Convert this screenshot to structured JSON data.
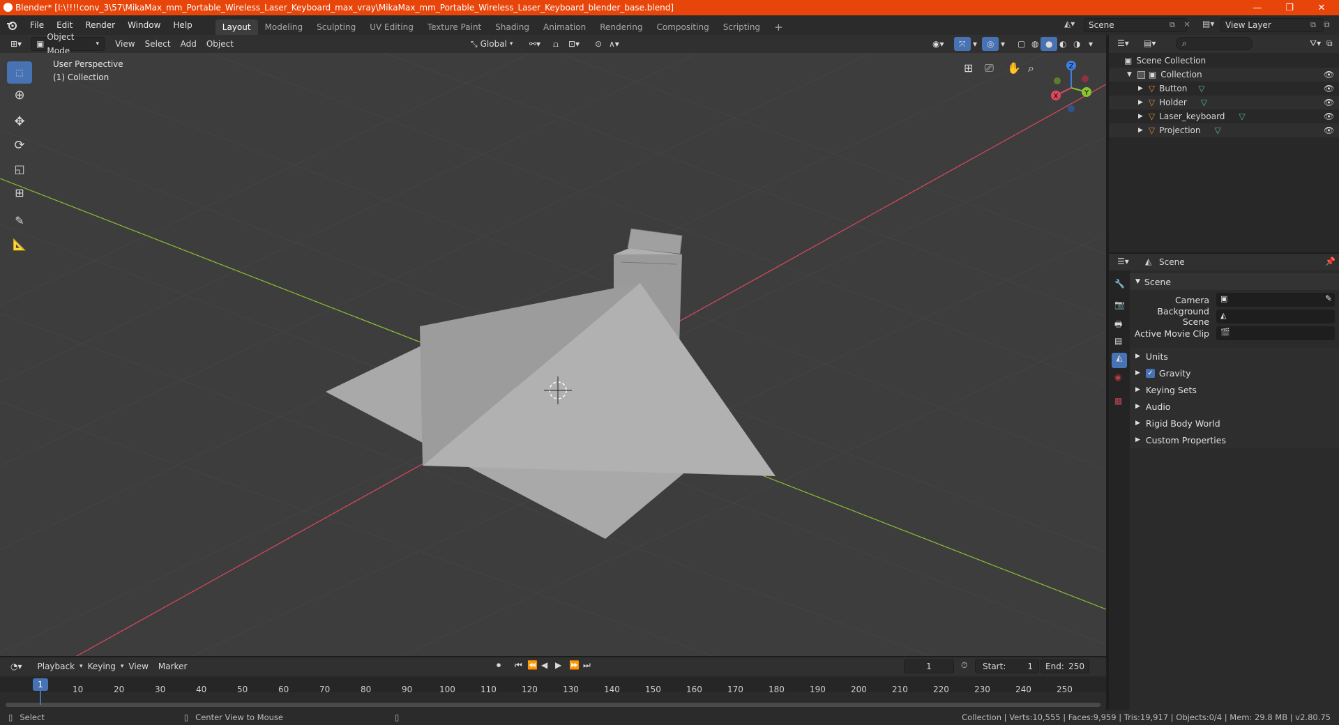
{
  "window": {
    "title": "Blender* [I:\\!!!!conv_3\\57\\MikaMax_mm_Portable_Wireless_Laser_Keyboard_max_vray\\MikaMax_mm_Portable_Wireless_Laser_Keyboard_blender_base.blend]",
    "minimize": "—",
    "maximize": "❐",
    "close": "✕"
  },
  "menu": [
    "File",
    "Edit",
    "Render",
    "Window",
    "Help"
  ],
  "workspaces": [
    "Layout",
    "Modeling",
    "Sculpting",
    "UV Editing",
    "Texture Paint",
    "Shading",
    "Animation",
    "Rendering",
    "Compositing",
    "Scripting"
  ],
  "workspace_add": "+",
  "top_right": {
    "scene": "Scene",
    "view_layer": "View Layer"
  },
  "viewport_header": {
    "mode": "Object Mode",
    "menus": [
      "View",
      "Select",
      "Add",
      "Object"
    ],
    "transform_orientation": "Global"
  },
  "viewport": {
    "perspective": "User Perspective",
    "collection": "(1) Collection",
    "gizmo_axes": {
      "z": "Z",
      "y": "Y",
      "x": "X"
    },
    "colors": {
      "x_axis": "#e0485e",
      "y_axis": "#8cc431",
      "z_axis": "#3f7fde",
      "grid": "#474747"
    }
  },
  "outliner": {
    "root": "Scene Collection",
    "collection": "Collection",
    "objects": [
      "Button",
      "Holder",
      "Laser_keyboard",
      "Projection"
    ]
  },
  "properties": {
    "header": "Scene",
    "section": "Scene",
    "fields": [
      {
        "label": "Camera",
        "value": ""
      },
      {
        "label": "Background Scene",
        "value": ""
      },
      {
        "label": "Active Movie Clip",
        "value": ""
      }
    ],
    "panels": [
      "Units",
      "Gravity",
      "Keying Sets",
      "Audio",
      "Rigid Body World",
      "Custom Properties"
    ],
    "gravity_checked": true
  },
  "timeline": {
    "menus": [
      "Playback",
      "Keying",
      "View",
      "Marker"
    ],
    "current_frame": "1",
    "start_label": "Start:",
    "start": "1",
    "end_label": "End:",
    "end": "250",
    "ruler": [
      "1",
      "10",
      "20",
      "30",
      "40",
      "50",
      "60",
      "70",
      "80",
      "90",
      "100",
      "110",
      "120",
      "130",
      "140",
      "150",
      "160",
      "170",
      "180",
      "190",
      "200",
      "210",
      "220",
      "230",
      "240",
      "250"
    ]
  },
  "statusbar": {
    "select": "Select",
    "center_view": "Center View to Mouse",
    "stats": "Collection | Verts:10,555 | Faces:9,959 | Tris:19,917 | Objects:0/4 | Mem: 29.8 MB | v2.80.75"
  }
}
